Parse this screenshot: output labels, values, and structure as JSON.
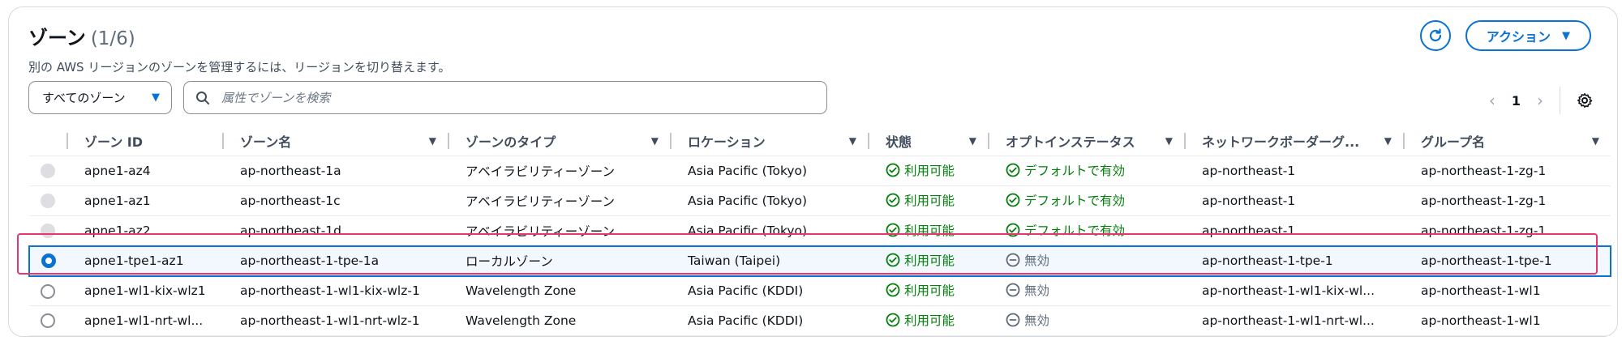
{
  "header": {
    "title": "ゾーン",
    "count": "(1/6)",
    "description": "別の AWS リージョンのゾーンを管理するには、リージョンを切り替えます。",
    "actions_label": "アクション"
  },
  "filter": {
    "select_value": "すべてのゾーン",
    "search_placeholder": "属性でゾーンを検索"
  },
  "pagination": {
    "page": "1"
  },
  "columns": [
    "ゾーン ID",
    "ゾーン名",
    "ゾーンのタイプ",
    "ロケーション",
    "状態",
    "オプトインステータス",
    "ネットワークボーダーグ...",
    "グループ名"
  ],
  "rows": [
    {
      "id": "apne1-az4",
      "name": "ap-northeast-1a",
      "type": "アベイラビリティーゾーン",
      "location": "Asia Pacific (Tokyo)",
      "state": "利用可能",
      "optin": "デフォルトで有効",
      "optin_ok": true,
      "border": "ap-northeast-1",
      "group": "ap-northeast-1-zg-1",
      "radio": "disabled"
    },
    {
      "id": "apne1-az1",
      "name": "ap-northeast-1c",
      "type": "アベイラビリティーゾーン",
      "location": "Asia Pacific (Tokyo)",
      "state": "利用可能",
      "optin": "デフォルトで有効",
      "optin_ok": true,
      "border": "ap-northeast-1",
      "group": "ap-northeast-1-zg-1",
      "radio": "disabled"
    },
    {
      "id": "apne1-az2",
      "name": "ap-northeast-1d",
      "type": "アベイラビリティーゾーン",
      "location": "Asia Pacific (Tokyo)",
      "state": "利用可能",
      "optin": "デフォルトで有効",
      "optin_ok": true,
      "border": "ap-northeast-1",
      "group": "ap-northeast-1-zg-1",
      "radio": "disabled"
    },
    {
      "id": "apne1-tpe1-az1",
      "name": "ap-northeast-1-tpe-1a",
      "type": "ローカルゾーン",
      "location": "Taiwan (Taipei)",
      "state": "利用可能",
      "optin": "無効",
      "optin_ok": false,
      "border": "ap-northeast-1-tpe-1",
      "group": "ap-northeast-1-tpe-1",
      "radio": "checked"
    },
    {
      "id": "apne1-wl1-kix-wlz1",
      "name": "ap-northeast-1-wl1-kix-wlz-1",
      "type": "Wavelength Zone",
      "location": "Asia Pacific (KDDI)",
      "state": "利用可能",
      "optin": "無効",
      "optin_ok": false,
      "border": "ap-northeast-1-wl1-kix-wl...",
      "group": "ap-northeast-1-wl1",
      "radio": "empty"
    },
    {
      "id": "apne1-wl1-nrt-wl...",
      "name": "ap-northeast-1-wl1-nrt-wlz-1",
      "type": "Wavelength Zone",
      "location": "Asia Pacific (KDDI)",
      "state": "利用可能",
      "optin": "無効",
      "optin_ok": false,
      "border": "ap-northeast-1-wl1-nrt-wl...",
      "group": "ap-northeast-1-wl1",
      "radio": "empty"
    }
  ],
  "colors": {
    "accent": "#0972d3",
    "success": "#037f0c",
    "muted": "#5f6b7a",
    "highlight": "#e8356f"
  },
  "icons": [
    "refresh-icon",
    "caret-down-icon",
    "search-icon",
    "chevron-left-icon",
    "chevron-right-icon",
    "gear-icon",
    "check-circle-icon",
    "minus-circle-icon"
  ]
}
